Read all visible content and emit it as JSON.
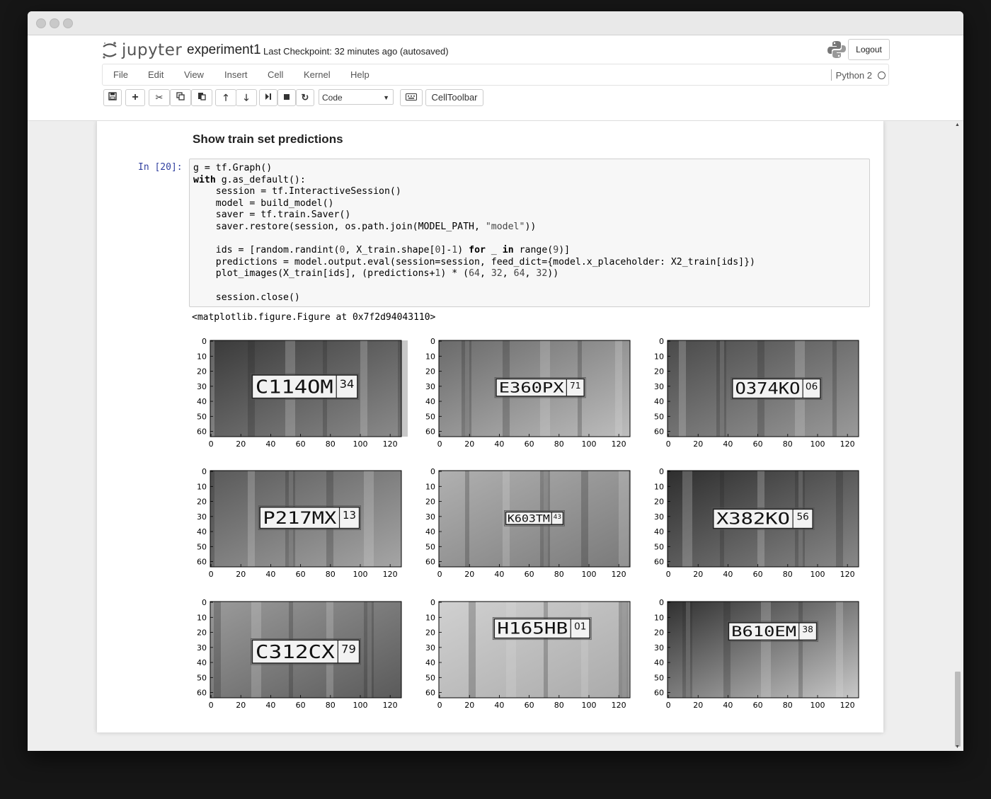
{
  "header": {
    "logo_text": "jupyter",
    "notebook_name": "experiment1",
    "checkpoint": "Last Checkpoint: 32 minutes ago (autosaved)",
    "logout_label": "Logout"
  },
  "menu": {
    "items": [
      "File",
      "Edit",
      "View",
      "Insert",
      "Cell",
      "Kernel",
      "Help"
    ],
    "kernel_name": "Python 2"
  },
  "toolbar": {
    "buttons": [
      "save-icon",
      "add-cell-icon",
      "cut-icon",
      "copy-icon",
      "paste-icon",
      "move-up-icon",
      "move-down-icon",
      "run-next-icon",
      "stop-icon",
      "restart-icon",
      "keyboard-icon"
    ],
    "cell_type": "Code",
    "celltoolbar_label": "CellToolbar"
  },
  "notebook": {
    "section_title": "Show train set predictions",
    "prompt": "In [20]:",
    "output_text": "<matplotlib.figure.Figure at 0x7f2d94043110>"
  },
  "plots": {
    "yticks": [
      "0",
      "10",
      "20",
      "30",
      "40",
      "50",
      "60"
    ],
    "xticks": [
      "0",
      "20",
      "40",
      "60",
      "80",
      "100",
      "120"
    ],
    "plates": [
      {
        "main": "C114OM",
        "region": "34"
      },
      {
        "main": "E360PX",
        "region": "71"
      },
      {
        "main": "O374KO",
        "region": "06"
      },
      {
        "main": "P217MX",
        "region": "13"
      },
      {
        "main": "K603TM",
        "region": "43"
      },
      {
        "main": "X382KO",
        "region": "56"
      },
      {
        "main": "C312CX",
        "region": "79"
      },
      {
        "main": "H165HB",
        "region": "01"
      },
      {
        "main": "B610EM",
        "region": "38"
      }
    ]
  },
  "colors": {
    "prompt_blue": "#303f9f"
  }
}
